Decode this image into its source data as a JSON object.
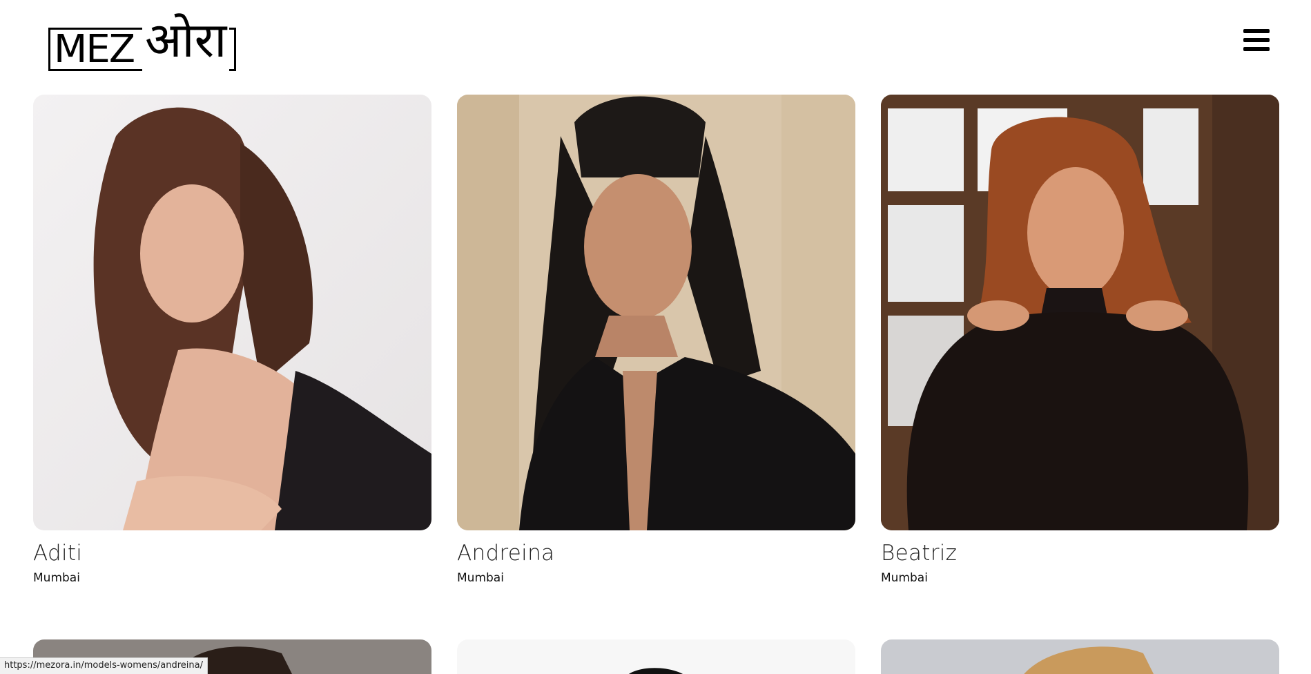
{
  "brand": {
    "latin": "MEZ",
    "devanagari": "ओरा"
  },
  "header": {
    "menu_icon": "hamburger-icon"
  },
  "models": [
    {
      "name": "Aditi",
      "city": "Mumbai"
    },
    {
      "name": "Andreina",
      "city": "Mumbai"
    },
    {
      "name": "Beatriz",
      "city": "Mumbai"
    }
  ],
  "status_bar": {
    "url": "https://mezora.in/models-womens/andreina/"
  }
}
